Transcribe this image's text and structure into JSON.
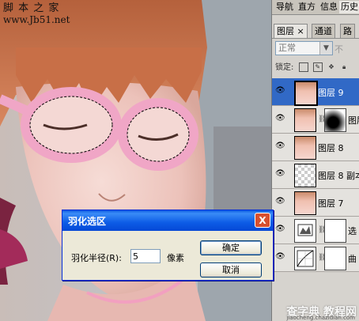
{
  "watermark": {
    "line1": "脚 本 之 家",
    "line2": "www.Jb51.net"
  },
  "panel": {
    "top_tabs": [
      "导航",
      "直方",
      "信息",
      "历史"
    ],
    "sub_tabs": [
      {
        "label": "图层",
        "close": "×"
      },
      {
        "label": "通道"
      },
      {
        "label": "路"
      }
    ],
    "blend_mode": "正常",
    "opacity_label": "不",
    "lock_label": "锁定:",
    "layers": [
      {
        "name": "图层 9",
        "selected": true,
        "thumb": "face",
        "mask": false
      },
      {
        "name": "图层",
        "selected": false,
        "thumb": "face",
        "mask": true,
        "mask_type": "gradient"
      },
      {
        "name": "图层 8",
        "selected": false,
        "thumb": "face",
        "mask": false
      },
      {
        "name": "图层 8 副本",
        "selected": false,
        "thumb": "checker",
        "mask": false
      },
      {
        "name": "图层 7",
        "selected": false,
        "thumb": "face",
        "mask": false
      },
      {
        "name": "选",
        "selected": false,
        "thumb": "adj-levels",
        "mask": true,
        "mask_type": "white"
      },
      {
        "name": "曲",
        "selected": false,
        "thumb": "adj-curves",
        "mask": true,
        "mask_type": "white"
      }
    ]
  },
  "dialog": {
    "title": "羽化选区",
    "close": "X",
    "field_label": "羽化半径(R):",
    "field_value": "5",
    "field_unit": "像素",
    "ok_label": "确定",
    "cancel_label": "取消"
  },
  "footer": {
    "text": "查字典 教程网",
    "sub": "jiaocheng.chazidian.com"
  }
}
